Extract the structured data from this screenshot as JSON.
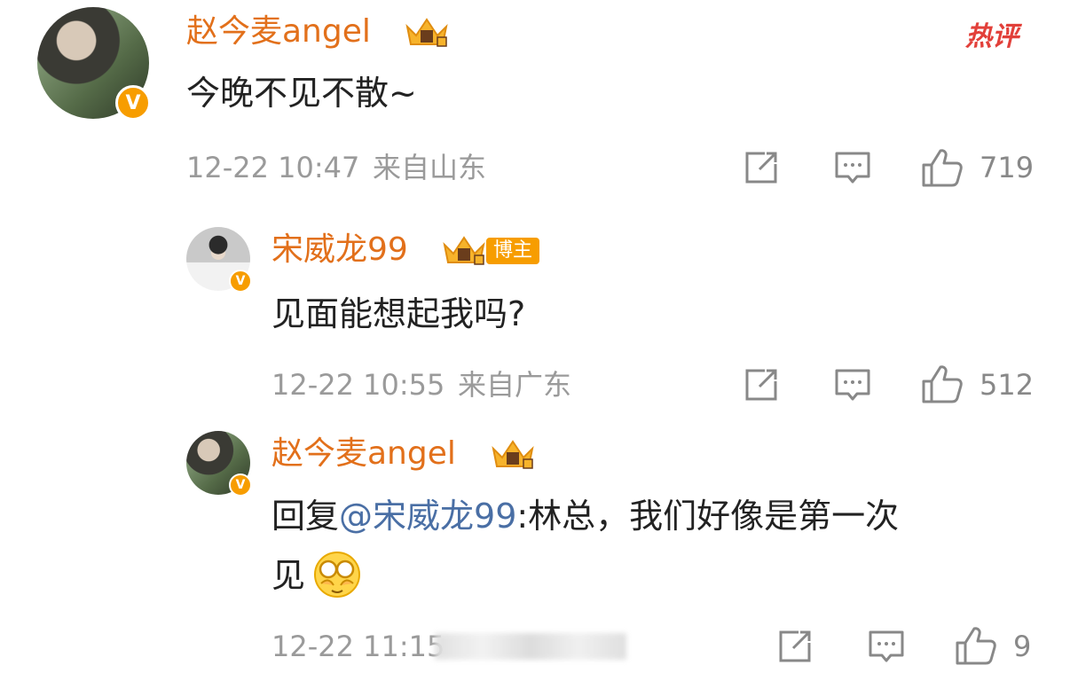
{
  "hot_label": "热评",
  "comments": [
    {
      "username": "赵今麦angel",
      "verified": "V",
      "content": "今晚不见不散~",
      "time": "12-22 10:47",
      "location": "来自山东",
      "likes": "719"
    },
    {
      "username": "宋威龙99",
      "verified": "V",
      "badge": "博主",
      "content": "见面能想起我吗?",
      "time": "12-22 10:55",
      "location": "来自广东",
      "likes": "512"
    },
    {
      "username": "赵今麦angel",
      "verified": "V",
      "reply_prefix": "回复",
      "mention": "@宋威龙99",
      "content_line1": ":林总，我们好像是第一次",
      "content_line2": "见",
      "time": "12-22 11:15",
      "likes": "9"
    }
  ],
  "icons": {
    "share": "share-icon",
    "comment": "comment-icon",
    "like": "thumbs-up-icon",
    "crown": "crown-badge-icon",
    "emoji": "cover-eyes-emoji"
  },
  "colors": {
    "username": "#e2701b",
    "verified": "#f79d00",
    "mention": "#4a6fa5",
    "meta": "#9a9a9a",
    "hot": "#e2403a"
  }
}
